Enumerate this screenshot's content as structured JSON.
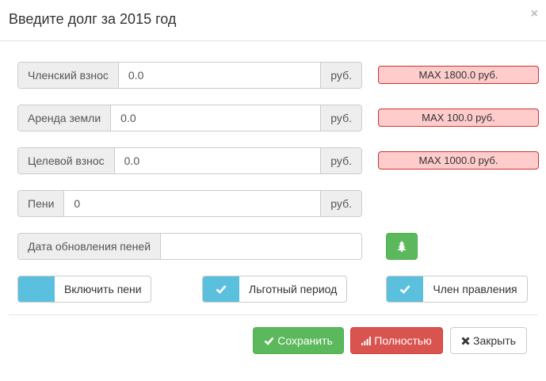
{
  "dialog": {
    "title": "Введите долг за 2015 год",
    "close_symbol": "×"
  },
  "fields": [
    {
      "label": "Членский взнос",
      "value": "0.0",
      "unit": "руб.",
      "max": "MAX 1800.0 руб."
    },
    {
      "label": "Аренда земли",
      "value": "0.0",
      "unit": "руб.",
      "max": "MAX 100.0 руб."
    },
    {
      "label": "Целевой взнос",
      "value": "0.0",
      "unit": "руб.",
      "max": "MAX 1000.0 руб."
    },
    {
      "label": "Пени",
      "value": "0",
      "unit": "руб."
    }
  ],
  "penalty_date": {
    "label": "Дата обновления пеней",
    "value": "",
    "button_icon": "tree-icon"
  },
  "toggles": [
    {
      "label": "Включить пени",
      "checked": false
    },
    {
      "label": "Льготный период",
      "checked": true
    },
    {
      "label": "Член правления",
      "checked": true
    }
  ],
  "buttons": {
    "save": "Сохранить",
    "full": "Полностью",
    "close": "Закрыть"
  },
  "colors": {
    "success": "#5cb85c",
    "danger": "#d9534f",
    "info": "#5bc0de",
    "max_bg": "#ffcccc",
    "max_border": "#cc3333"
  }
}
